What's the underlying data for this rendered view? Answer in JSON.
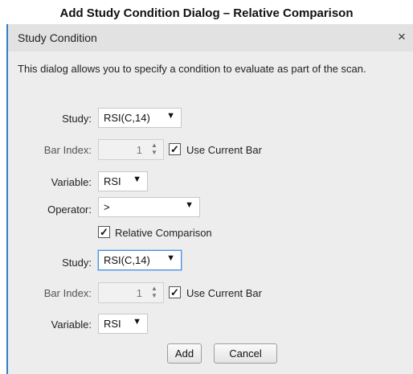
{
  "caption": "Add Study Condition Dialog – Relative Comparison",
  "dialog": {
    "title": "Study Condition",
    "close_glyph": "×",
    "description": "This dialog allows you to specify a condition to evaluate as part of the scan.",
    "accent_color": "#2f7fc8"
  },
  "left_side": {
    "study_label": "Study:",
    "study_value": "RSI(C,14)",
    "bar_index_label": "Bar Index:",
    "bar_index_value": "1",
    "use_current_bar_label": "Use Current Bar",
    "use_current_bar_checked": true,
    "variable_label": "Variable:",
    "variable_value": "RSI"
  },
  "operator": {
    "label": "Operator:",
    "value": ">"
  },
  "relative_comparison": {
    "label": "Relative Comparison",
    "checked": true
  },
  "right_side": {
    "study_label": "Study:",
    "study_value": "RSI(C,14)",
    "bar_index_label": "Bar Index:",
    "bar_index_value": "1",
    "use_current_bar_label": "Use Current Bar",
    "use_current_bar_checked": true,
    "variable_label": "Variable:",
    "variable_value": "RSI"
  },
  "icons": {
    "dropdown": "▼",
    "checkmark": "✓",
    "spin_up": "▲",
    "spin_down": "▼"
  },
  "buttons": {
    "add": "Add",
    "cancel": "Cancel"
  }
}
